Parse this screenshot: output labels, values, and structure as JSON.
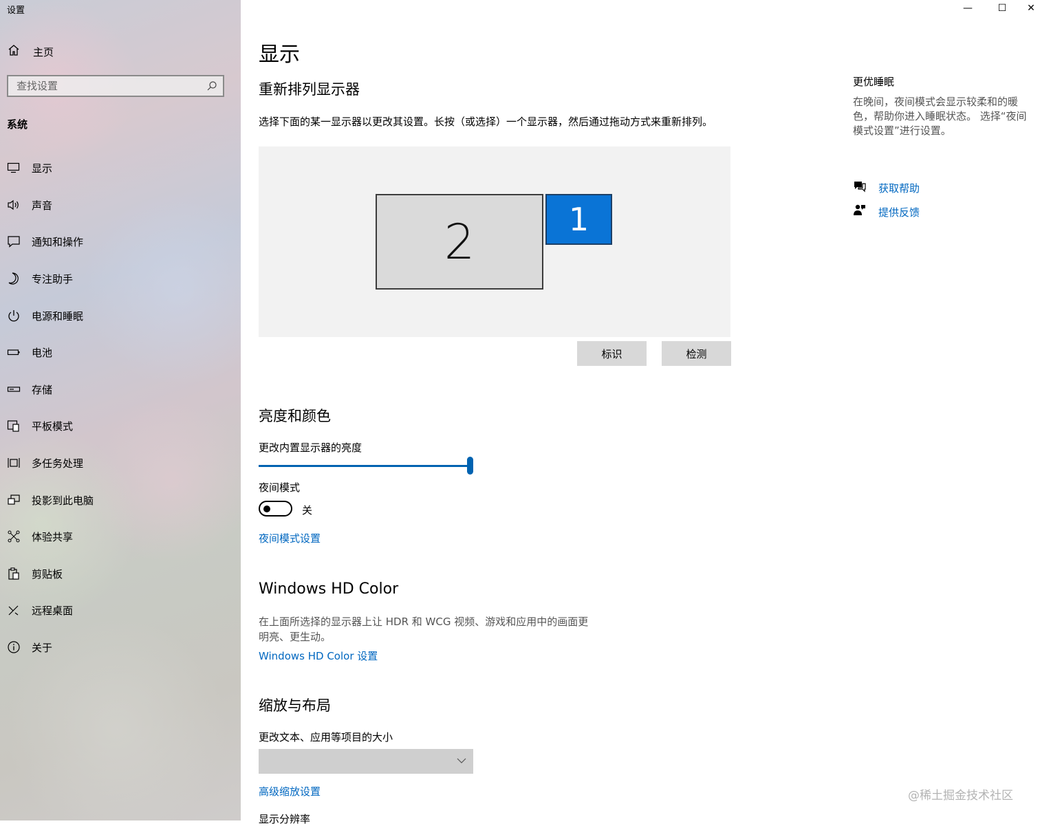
{
  "window": {
    "title": "设置",
    "minimize": "—",
    "maximize": "☐",
    "close": "✕"
  },
  "sidebar": {
    "home_label": "主页",
    "search_placeholder": "查找设置",
    "section_title": "系统",
    "items": [
      {
        "label": "显示",
        "icon": "monitor-icon"
      },
      {
        "label": "声音",
        "icon": "speaker-icon"
      },
      {
        "label": "通知和操作",
        "icon": "notification-icon"
      },
      {
        "label": "专注助手",
        "icon": "moon-icon"
      },
      {
        "label": "电源和睡眠",
        "icon": "power-icon"
      },
      {
        "label": "电池",
        "icon": "battery-icon"
      },
      {
        "label": "存储",
        "icon": "storage-icon"
      },
      {
        "label": "平板模式",
        "icon": "tablet-icon"
      },
      {
        "label": "多任务处理",
        "icon": "multitask-icon"
      },
      {
        "label": "投影到此电脑",
        "icon": "project-icon"
      },
      {
        "label": "体验共享",
        "icon": "share-icon"
      },
      {
        "label": "剪贴板",
        "icon": "clipboard-icon"
      },
      {
        "label": "远程桌面",
        "icon": "remote-icon"
      },
      {
        "label": "关于",
        "icon": "info-icon"
      }
    ]
  },
  "main": {
    "page_title": "显示",
    "rearrange": {
      "title": "重新排列显示器",
      "description": "选择下面的某一显示器以更改其设置。长按（或选择）一个显示器，然后通过拖动方式来重新排列。",
      "monitors": [
        {
          "number": "2",
          "selected": false
        },
        {
          "number": "1",
          "selected": true
        }
      ],
      "identify_label": "标识",
      "detect_label": "检测"
    },
    "brightness": {
      "title": "亮度和颜色",
      "slider_label": "更改内置显示器的亮度",
      "slider_value_percent": 100,
      "night_mode_label": "夜间模式",
      "night_mode_state": "关",
      "night_mode_settings_link": "夜间模式设置"
    },
    "hdr": {
      "title": "Windows HD Color",
      "description_line1": "在上面所选择的显示器上让 HDR 和 WCG 视频、游戏和应用中的画面更",
      "description_line2": "明亮、更生动。",
      "settings_link": "Windows HD Color 设置"
    },
    "scale": {
      "title": "缩放与布局",
      "size_label": "更改文本、应用等项目的大小",
      "dropdown_value": "",
      "advanced_link": "高级缩放设置",
      "resolution_label_partial": "显示分辨率"
    }
  },
  "right": {
    "sleep_title": "更优睡眠",
    "sleep_desc_line1": "在晚间，夜间模式会显示较柔和的暖",
    "sleep_desc_line2": "色，帮助你进入睡眠状态。 选择“夜间",
    "sleep_desc_line3": "模式设置”进行设置。",
    "help_link": "获取帮助",
    "feedback_link": "提供反馈"
  },
  "watermark": "@稀土掘金技术社区",
  "colors": {
    "accent": "#0067c0",
    "selected_monitor": "#0a74d6",
    "slider": "#0063b1"
  }
}
